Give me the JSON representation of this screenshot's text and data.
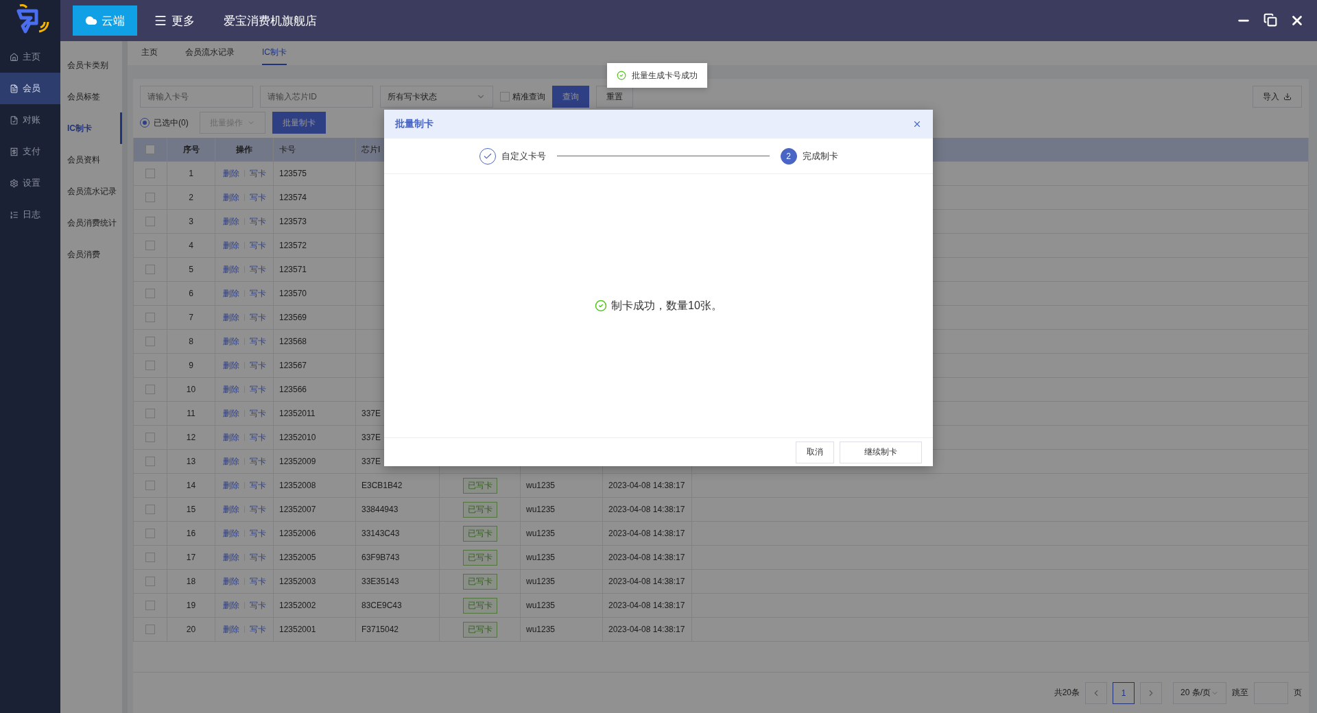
{
  "title_bar": {
    "cloud_button": "云端",
    "more_button": "更多",
    "store_name": "爱宝消费机旗舰店"
  },
  "nav": {
    "items": [
      {
        "label": "主页",
        "selected": false
      },
      {
        "label": "会员",
        "selected": true
      },
      {
        "label": "对账",
        "selected": false
      },
      {
        "label": "支付",
        "selected": false
      },
      {
        "label": "设置",
        "selected": false
      },
      {
        "label": "日志",
        "selected": false
      }
    ]
  },
  "sub_nav": {
    "items": [
      {
        "label": "会员卡类别",
        "selected": false
      },
      {
        "label": "会员标签",
        "selected": false
      },
      {
        "label": "IC制卡",
        "selected": true
      },
      {
        "label": "会员资料",
        "selected": false
      },
      {
        "label": "会员流水记录",
        "selected": false
      },
      {
        "label": "会员消费统计",
        "selected": false
      },
      {
        "label": "会员消费",
        "selected": false
      }
    ]
  },
  "tabs": [
    {
      "label": "主页",
      "selected": false
    },
    {
      "label": "会员流水记录",
      "selected": false
    },
    {
      "label": "IC制卡",
      "selected": true
    }
  ],
  "filters": {
    "card_placeholder": "请输入卡号",
    "chip_placeholder": "请输入芯片ID",
    "status_select": "所有写卡状态",
    "exact_match": {
      "label": "精准查询",
      "checked": false
    },
    "query_button": "查询",
    "reset_button": "重置",
    "import_button": "导入"
  },
  "selection": {
    "label": "已选中(0)",
    "selected": true
  },
  "batch_menu": {
    "label": "批量操作",
    "disabled": true
  },
  "batch_button": "批量制卡",
  "table": {
    "all_checked": false,
    "columns": [
      "序号",
      "操作",
      "卡号",
      "芯片I"
    ],
    "rows": [
      {
        "checked": false,
        "index": "1",
        "actions": [
          "删除",
          "写卡"
        ],
        "card": "123575"
      },
      {
        "checked": false,
        "index": "2",
        "actions": [
          "删除",
          "写卡"
        ],
        "card": "123574"
      },
      {
        "checked": false,
        "index": "3",
        "actions": [
          "删除",
          "写卡"
        ],
        "card": "123573"
      },
      {
        "checked": false,
        "index": "4",
        "actions": [
          "删除",
          "写卡"
        ],
        "card": "123572"
      },
      {
        "checked": false,
        "index": "5",
        "actions": [
          "删除",
          "写卡"
        ],
        "card": "123571"
      },
      {
        "checked": false,
        "index": "6",
        "actions": [
          "删除",
          "写卡"
        ],
        "card": "123570"
      },
      {
        "checked": false,
        "index": "7",
        "actions": [
          "删除",
          "写卡"
        ],
        "card": "123569"
      },
      {
        "checked": false,
        "index": "8",
        "actions": [
          "删除",
          "写卡"
        ],
        "card": "123568"
      },
      {
        "checked": false,
        "index": "9",
        "actions": [
          "删除",
          "写卡"
        ],
        "card": "123567"
      },
      {
        "checked": false,
        "index": "10",
        "actions": [
          "删除",
          "写卡"
        ],
        "card": "123566"
      },
      {
        "checked": false,
        "index": "11",
        "actions": [
          "删除",
          "写卡"
        ],
        "card": "12352011",
        "chip": "337E"
      },
      {
        "checked": false,
        "index": "12",
        "actions": [
          "删除",
          "写卡"
        ],
        "card": "12352010",
        "chip": "337E"
      },
      {
        "checked": false,
        "index": "13",
        "actions": [
          "删除",
          "写卡"
        ],
        "card": "12352009",
        "chip": "337E"
      },
      {
        "checked": false,
        "index": "14",
        "actions": [
          "删除",
          "写卡"
        ],
        "card": "12352008",
        "chip": "E3CB1B42",
        "status": "已写卡",
        "operator": "wu1235",
        "time": "2023-04-08 14:38:17"
      },
      {
        "checked": false,
        "index": "15",
        "actions": [
          "删除",
          "写卡"
        ],
        "card": "12352007",
        "chip": "33844943",
        "status": "已写卡",
        "operator": "wu1235",
        "time": "2023-04-08 14:38:17"
      },
      {
        "checked": false,
        "index": "16",
        "actions": [
          "删除",
          "写卡"
        ],
        "card": "12352006",
        "chip": "33143C43",
        "status": "已写卡",
        "operator": "wu1235",
        "time": "2023-04-08 14:38:17"
      },
      {
        "checked": false,
        "index": "17",
        "actions": [
          "删除",
          "写卡"
        ],
        "card": "12352005",
        "chip": "63F9B743",
        "status": "已写卡",
        "operator": "wu1235",
        "time": "2023-04-08 14:38:17"
      },
      {
        "checked": false,
        "index": "18",
        "actions": [
          "删除",
          "写卡"
        ],
        "card": "12352003",
        "chip": "33E35143",
        "status": "已写卡",
        "operator": "wu1235",
        "time": "2023-04-08 14:38:17"
      },
      {
        "checked": false,
        "index": "19",
        "actions": [
          "删除",
          "写卡"
        ],
        "card": "12352002",
        "chip": "83CE9C43",
        "status": "已写卡",
        "operator": "wu1235",
        "time": "2023-04-08 14:38:17"
      },
      {
        "checked": false,
        "index": "20",
        "actions": [
          "删除",
          "写卡"
        ],
        "card": "12352001",
        "chip": "F3715042",
        "status": "已写卡",
        "operator": "wu1235",
        "time": "2023-04-08 14:38:17"
      }
    ]
  },
  "pagination": {
    "total": "共20条",
    "pages": [
      {
        "label": "1",
        "selected": true
      }
    ],
    "page_size": "20 条/页",
    "goto_label": "跳至",
    "page_suffix": "页"
  },
  "toast": {
    "text": "批量生成卡号成功"
  },
  "dialog": {
    "title": "批量制卡",
    "steps": [
      {
        "label": "自定义卡号",
        "done": true
      },
      {
        "label": "完成制卡",
        "number": "2",
        "done": false
      }
    ],
    "message": "制卡成功，数量10张。",
    "buttons": [
      {
        "label": "取消",
        "kind": "cancel"
      },
      {
        "label": "继续制卡",
        "kind": "continue"
      }
    ]
  }
}
